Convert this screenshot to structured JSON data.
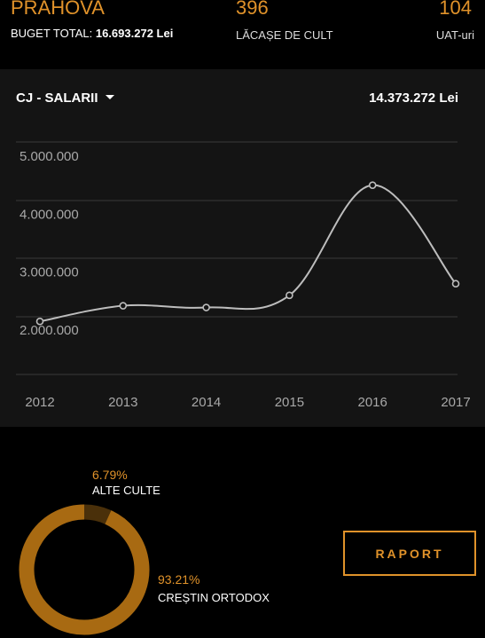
{
  "header": {
    "county": "PRAHOVA",
    "budget_label": "BUGET TOTAL:",
    "budget_value": "16.693.272 Lei",
    "worship_count": "396",
    "worship_label": "LĂCAȘE DE CULT",
    "uat_count": "104",
    "uat_label": "UAT-uri"
  },
  "panel": {
    "selector_label": "CJ - SALARII",
    "total": "14.373.272 Lei"
  },
  "chart_data": {
    "type": "line",
    "x": [
      2012,
      2013,
      2014,
      2015,
      2016,
      2017
    ],
    "categories": [
      "2012",
      "2013",
      "2014",
      "2015",
      "2016",
      "2017"
    ],
    "values": [
      2150000,
      2420000,
      2390000,
      2600000,
      4500000,
      2800000
    ],
    "y_ticks": [
      "5.000.000",
      "4.000.000",
      "3.000.000",
      "2.000.000"
    ],
    "y_tick_values": [
      5000000,
      4000000,
      3000000,
      2000000
    ],
    "ylim": [
      1000000,
      5250000
    ],
    "grid": true,
    "colors": {
      "line": "#bdbdbd",
      "grid": "#3a3a3a",
      "tick": "#a8a8a8"
    }
  },
  "distribution": {
    "items": [
      {
        "pct": "6.79%",
        "label": "ALTE CULTE",
        "value": 6.79,
        "color": "#4a300a"
      },
      {
        "pct": "93.21%",
        "label": "CREȘTIN ORTODOX",
        "value": 93.21,
        "color": "#a86a12"
      }
    ]
  },
  "actions": {
    "report_label": "RAPORT"
  }
}
